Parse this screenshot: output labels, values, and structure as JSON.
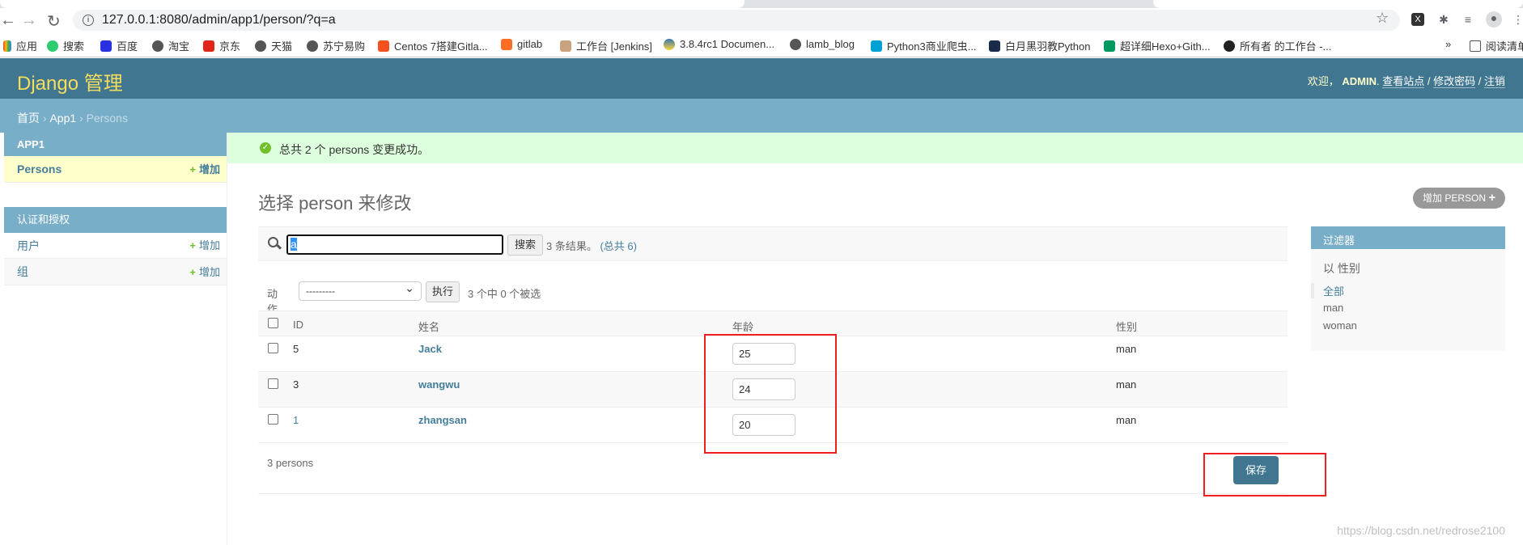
{
  "browser": {
    "url": "127.0.0.1:8080/admin/app1/person/?q=a",
    "bookmarks": [
      "应用",
      "搜索",
      "百度",
      "淘宝",
      "京东",
      "天猫",
      "苏宁易购",
      "Centos 7搭建Gitla...",
      "gitlab",
      "工作台 [Jenkins]",
      "3.8.4rc1 Documen...",
      "lamb_blog",
      "Python3商业爬虫...",
      "白月黑羽教Python",
      "超详细Hexo+Gith...",
      "所有者 的工作台 -..."
    ],
    "more": "»",
    "reading_list": "阅读清单"
  },
  "header": {
    "brand": "Django 管理",
    "welcome": "欢迎，",
    "user": "ADMIN",
    "view_site": "查看站点",
    "change_password": "修改密码",
    "logout": "注销",
    "sep": "/"
  },
  "breadcrumbs": {
    "home": "首页",
    "app": "App1",
    "current": "Persons",
    "sep": "›"
  },
  "sidebar": {
    "modules": [
      {
        "title": "APP1",
        "items": [
          {
            "label": "Persons",
            "add": "增加"
          }
        ]
      },
      {
        "title": "认证和授权",
        "items": [
          {
            "label": "用户",
            "add": "增加"
          },
          {
            "label": "组",
            "add": "增加"
          }
        ]
      }
    ]
  },
  "message": "总共 2 个 persons 变更成功。",
  "title": "选择 person 来修改",
  "add_button": "增加 PERSON",
  "search": {
    "value": "a",
    "button": "搜索",
    "result": "3 条结果。",
    "total": "(总共 6)"
  },
  "actions": {
    "label": "动作",
    "selected": "---------",
    "go": "执行",
    "count": "3 个中 0 个被选"
  },
  "table": {
    "headers": [
      "ID",
      "姓名",
      "年龄",
      "性别"
    ],
    "rows": [
      {
        "id": "5",
        "name": "Jack",
        "age": "25",
        "gender": "man"
      },
      {
        "id": "3",
        "name": "wangwu",
        "age": "24",
        "gender": "man"
      },
      {
        "id": "1",
        "name": "zhangsan",
        "age": "20",
        "gender": "man"
      }
    ]
  },
  "paginator": {
    "count": "3 persons",
    "save": "保存"
  },
  "filter": {
    "title": "过滤器",
    "by": "以 性别",
    "options": [
      "全部",
      "man",
      "woman"
    ]
  },
  "watermark": "https://blog.csdn.net/redrose2100",
  "colors": {
    "header": "#417690",
    "accent": "#79aec8",
    "brand": "#f5dd5d",
    "success": "#dfd",
    "highlight": "#f02020"
  }
}
